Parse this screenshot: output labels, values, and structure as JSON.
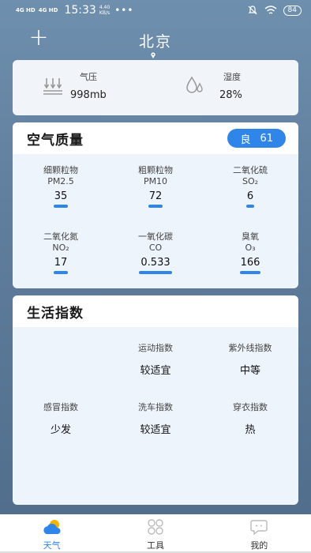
{
  "status_bar": {
    "sig1": "4G HD",
    "sig2": "4G HD",
    "time": "15:33",
    "net_speed_value": "4.40",
    "net_speed_unit": "KB/s",
    "more": "•••",
    "battery": "84"
  },
  "header": {
    "add_label": "+",
    "city": "北京"
  },
  "pressure": {
    "pressure_label": "气压",
    "pressure_value": "998mb",
    "humidity_label": "湿度",
    "humidity_value": "28%"
  },
  "air_quality": {
    "title": "空气质量",
    "level": "良",
    "aqi": "61",
    "items": [
      {
        "name": "细颗粒物",
        "code": "PM2.5",
        "value": "35"
      },
      {
        "name": "粗颗粒物",
        "code": "PM10",
        "value": "72"
      },
      {
        "name": "二氧化硫",
        "code": "SO₂",
        "value": "6"
      },
      {
        "name": "二氧化氮",
        "code": "NO₂",
        "value": "17"
      },
      {
        "name": "一氧化碳",
        "code": "CO",
        "value": "0.533"
      },
      {
        "name": "臭氧",
        "code": "O₃",
        "value": "166"
      }
    ]
  },
  "life": {
    "title": "生活指数",
    "items": [
      {
        "name": "运动指数",
        "value": "较适宜"
      },
      {
        "name": "紫外线指数",
        "value": "中等"
      },
      {
        "name": "感冒指数",
        "value": "少发"
      },
      {
        "name": "洗车指数",
        "value": "较适宜"
      },
      {
        "name": "穿衣指数",
        "value": "热"
      }
    ]
  },
  "nav": {
    "weather": "天气",
    "tools": "工具",
    "mine": "我的"
  },
  "colors": {
    "accent": "#2f86e8",
    "background_top": "#6f8fae",
    "background_bottom": "#4f6c8b"
  }
}
